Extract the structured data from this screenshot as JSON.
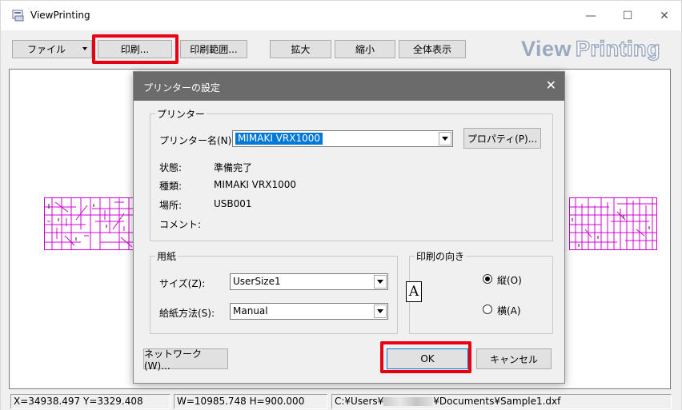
{
  "app": {
    "title": "ViewPrinting",
    "brand_part1": "View",
    "brand_part2": "Printing",
    "accent_red": "#e60012"
  },
  "window_controls": {
    "minimize": "—",
    "maximize": "☐",
    "close": "✕"
  },
  "toolbar": {
    "file": "ファイル",
    "print": "印刷...",
    "print_range": "印刷範囲...",
    "zoom_in": "拡大",
    "zoom_out": "縮小",
    "fit_all": "全体表示"
  },
  "status": {
    "cursor": "X=34938.497 Y=3329.408",
    "size": "W=10985.748 H=900.000",
    "path_prefix": "C:¥Users¥",
    "path_suffix": "¥Documents¥Sample1.dxf"
  },
  "dialog": {
    "title": "プリンターの設定",
    "close": "✕",
    "printer_group": "プリンター",
    "printer_name_label": "プリンター名(N):",
    "printer_name_value": "MIMAKI VRX1000",
    "properties_button": "プロパティ(P)...",
    "status_label": "状態:",
    "status_value": "準備完了",
    "type_label": "種類:",
    "type_value": "MIMAKI VRX1000",
    "location_label": "場所:",
    "location_value": "USB001",
    "comment_label": "コメント:",
    "paper_group": "用紙",
    "size_label": "サイズ(Z):",
    "size_value": "UserSize1",
    "source_label": "給紙方法(S):",
    "source_value": "Manual",
    "orientation_group": "印刷の向き",
    "orientation_glyph": "A",
    "portrait": "縦(O)",
    "landscape": "横(A)",
    "network_button": "ネットワーク(W)...",
    "ok_button": "OK",
    "cancel_button": "キャンセル"
  }
}
